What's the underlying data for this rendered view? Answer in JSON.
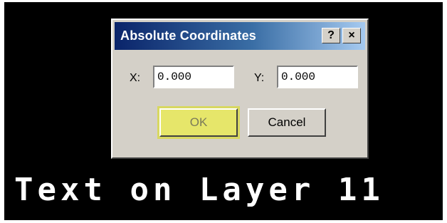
{
  "dialog": {
    "title": "Absolute Coordinates",
    "help_glyph": "?",
    "close_glyph": "×",
    "x_label": "X:",
    "x_value": "0.000",
    "y_label": "Y:",
    "y_value": "0.000",
    "ok_label": "OK",
    "cancel_label": "Cancel"
  },
  "canvas": {
    "caption": "Text on Layer 11"
  },
  "colors": {
    "titlebar_start": "#0a246a",
    "titlebar_end": "#a6caf0",
    "ok_highlight": "#e6e66a",
    "canvas_background": "#000000"
  }
}
